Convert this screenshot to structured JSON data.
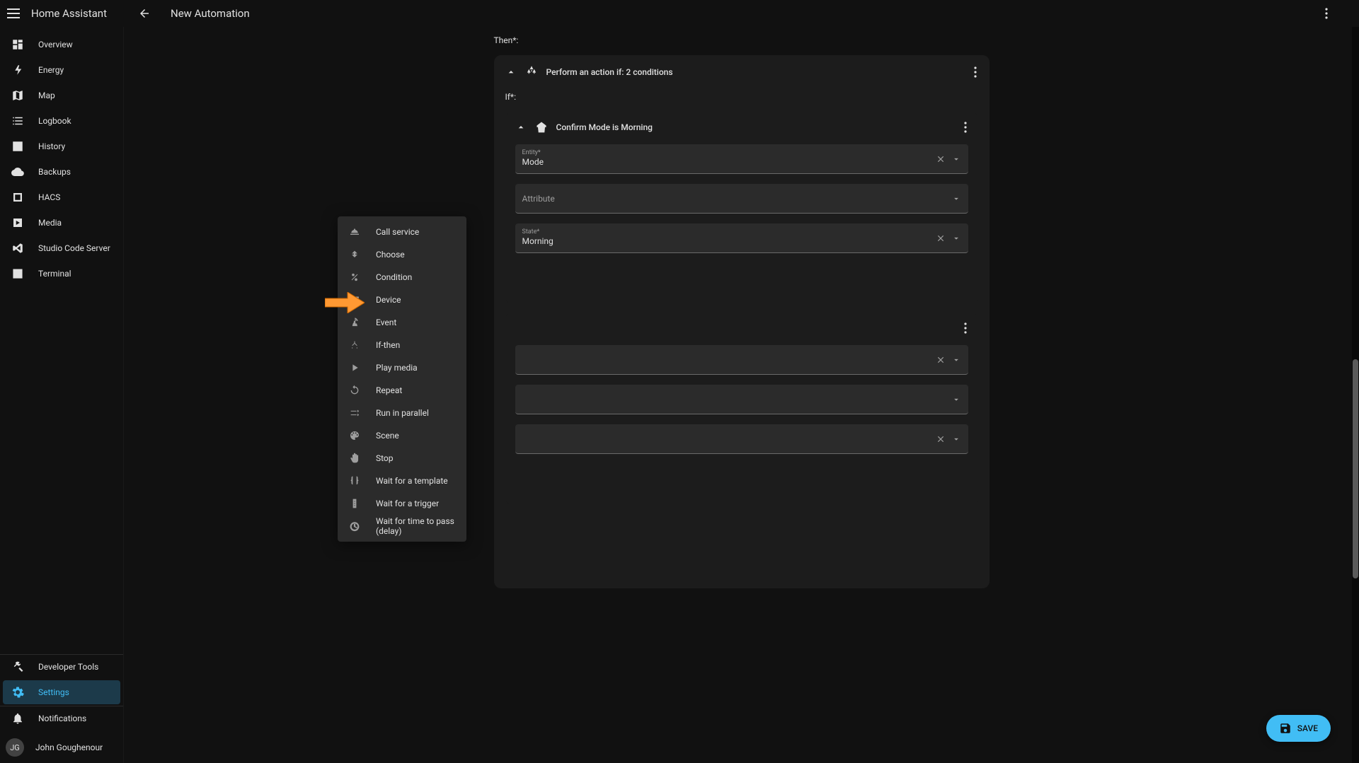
{
  "app": {
    "title": "Home Assistant"
  },
  "page": {
    "title": "New Automation"
  },
  "sidebar": {
    "items": [
      {
        "label": "Overview"
      },
      {
        "label": "Energy"
      },
      {
        "label": "Map"
      },
      {
        "label": "Logbook"
      },
      {
        "label": "History"
      },
      {
        "label": "Backups"
      },
      {
        "label": "HACS"
      },
      {
        "label": "Media"
      },
      {
        "label": "Studio Code Server"
      },
      {
        "label": "Terminal"
      }
    ],
    "bottom": [
      {
        "label": "Developer Tools"
      },
      {
        "label": "Settings"
      },
      {
        "label": "Notifications"
      }
    ],
    "user": {
      "initials": "JG",
      "name": "John Goughenour"
    }
  },
  "automation": {
    "then_label": "Then*:",
    "action_card": {
      "title": "Perform an action if: 2 conditions"
    },
    "if_label": "If*:",
    "condition1": {
      "title": "Confirm Mode is Morning",
      "entity_label": "Entity*",
      "entity_value": "Mode",
      "attribute_label": "Attribute",
      "state_label": "State*",
      "state_value": "Morning"
    }
  },
  "action_menu": {
    "items": [
      {
        "label": "Call service"
      },
      {
        "label": "Choose"
      },
      {
        "label": "Condition"
      },
      {
        "label": "Device"
      },
      {
        "label": "Event"
      },
      {
        "label": "If-then"
      },
      {
        "label": "Play media"
      },
      {
        "label": "Repeat"
      },
      {
        "label": "Run in parallel"
      },
      {
        "label": "Scene"
      },
      {
        "label": "Stop"
      },
      {
        "label": "Wait for a template"
      },
      {
        "label": "Wait for a trigger"
      },
      {
        "label": "Wait for time to pass (delay)"
      }
    ]
  },
  "save_button": "SAVE"
}
